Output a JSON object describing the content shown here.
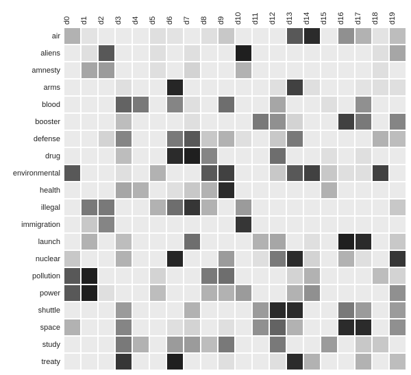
{
  "chart_data": {
    "type": "heatmap",
    "title": "",
    "xlabel": "",
    "ylabel": "",
    "row_labels": [
      "air",
      "aliens",
      "amnesty",
      "arms",
      "blood",
      "booster",
      "defense",
      "drug",
      "environmental",
      "health",
      "illegal",
      "immigration",
      "launch",
      "nuclear",
      "pollution",
      "power",
      "shuttle",
      "space",
      "study",
      "treaty"
    ],
    "col_labels": [
      "d0",
      "d1",
      "d2",
      "d3",
      "d4",
      "d5",
      "d6",
      "d7",
      "d8",
      "d9",
      "d10",
      "d11",
      "d12",
      "d13",
      "d14",
      "d15",
      "d16",
      "d17",
      "d18",
      "d19"
    ],
    "value_range": [
      0,
      1
    ],
    "matrix": [
      [
        0.3,
        0.08,
        0.05,
        0.05,
        0.05,
        0.1,
        0.08,
        0.05,
        0.1,
        0.2,
        0.05,
        0.05,
        0.05,
        0.7,
        0.9,
        0.05,
        0.45,
        0.3,
        0.08,
        0.25
      ],
      [
        0.05,
        0.1,
        0.7,
        0.05,
        0.05,
        0.1,
        0.05,
        0.1,
        0.05,
        0.05,
        0.95,
        0.05,
        0.05,
        0.05,
        0.05,
        0.05,
        0.05,
        0.05,
        0.1,
        0.35
      ],
      [
        0.05,
        0.35,
        0.4,
        0.05,
        0.05,
        0.1,
        0.05,
        0.15,
        0.05,
        0.05,
        0.3,
        0.05,
        0.05,
        0.05,
        0.05,
        0.05,
        0.05,
        0.05,
        0.1,
        0.05
      ],
      [
        0.05,
        0.05,
        0.05,
        0.1,
        0.05,
        0.05,
        0.92,
        0.05,
        0.05,
        0.05,
        0.05,
        0.05,
        0.1,
        0.8,
        0.1,
        0.05,
        0.05,
        0.08,
        0.1,
        0.1
      ],
      [
        0.05,
        0.05,
        0.05,
        0.65,
        0.55,
        0.05,
        0.5,
        0.1,
        0.05,
        0.6,
        0.05,
        0.05,
        0.35,
        0.05,
        0.05,
        0.1,
        0.05,
        0.45,
        0.05,
        0.05
      ],
      [
        0.05,
        0.05,
        0.05,
        0.25,
        0.05,
        0.05,
        0.05,
        0.1,
        0.05,
        0.05,
        0.05,
        0.55,
        0.45,
        0.15,
        0.05,
        0.05,
        0.8,
        0.55,
        0.05,
        0.5
      ],
      [
        0.05,
        0.05,
        0.15,
        0.5,
        0.05,
        0.05,
        0.55,
        0.7,
        0.2,
        0.3,
        0.1,
        0.05,
        0.2,
        0.55,
        0.05,
        0.05,
        0.05,
        0.05,
        0.3,
        0.25
      ],
      [
        0.05,
        0.05,
        0.05,
        0.25,
        0.05,
        0.05,
        0.9,
        0.95,
        0.5,
        0.05,
        0.05,
        0.05,
        0.6,
        0.05,
        0.05,
        0.1,
        0.05,
        0.1,
        0.05,
        0.05
      ],
      [
        0.7,
        0.05,
        0.05,
        0.1,
        0.05,
        0.3,
        0.05,
        0.05,
        0.7,
        0.8,
        0.05,
        0.05,
        0.2,
        0.7,
        0.8,
        0.2,
        0.1,
        0.1,
        0.8,
        0.05
      ],
      [
        0.05,
        0.05,
        0.05,
        0.35,
        0.3,
        0.05,
        0.1,
        0.2,
        0.3,
        0.9,
        0.05,
        0.05,
        0.05,
        0.05,
        0.05,
        0.3,
        0.05,
        0.05,
        0.05,
        0.05
      ],
      [
        0.05,
        0.55,
        0.55,
        0.05,
        0.05,
        0.3,
        0.6,
        0.85,
        0.3,
        0.05,
        0.4,
        0.05,
        0.05,
        0.05,
        0.05,
        0.05,
        0.05,
        0.05,
        0.05,
        0.2
      ],
      [
        0.05,
        0.2,
        0.5,
        0.05,
        0.05,
        0.05,
        0.05,
        0.05,
        0.05,
        0.05,
        0.85,
        0.05,
        0.05,
        0.05,
        0.05,
        0.05,
        0.05,
        0.05,
        0.05,
        0.05
      ],
      [
        0.05,
        0.3,
        0.05,
        0.25,
        0.05,
        0.05,
        0.05,
        0.6,
        0.05,
        0.05,
        0.05,
        0.3,
        0.35,
        0.05,
        0.1,
        0.05,
        0.95,
        0.9,
        0.05,
        0.2
      ],
      [
        0.2,
        0.05,
        0.05,
        0.3,
        0.05,
        0.05,
        0.92,
        0.05,
        0.05,
        0.4,
        0.05,
        0.1,
        0.55,
        0.9,
        0.15,
        0.05,
        0.3,
        0.1,
        0.05,
        0.85
      ],
      [
        0.7,
        0.95,
        0.05,
        0.05,
        0.05,
        0.15,
        0.05,
        0.05,
        0.55,
        0.6,
        0.05,
        0.05,
        0.05,
        0.15,
        0.3,
        0.05,
        0.05,
        0.05,
        0.25,
        0.15
      ],
      [
        0.7,
        0.95,
        0.1,
        0.05,
        0.05,
        0.25,
        0.05,
        0.05,
        0.3,
        0.3,
        0.4,
        0.05,
        0.05,
        0.3,
        0.45,
        0.05,
        0.05,
        0.05,
        0.05,
        0.45
      ],
      [
        0.05,
        0.05,
        0.05,
        0.4,
        0.05,
        0.05,
        0.05,
        0.3,
        0.05,
        0.05,
        0.05,
        0.4,
        0.9,
        0.9,
        0.05,
        0.05,
        0.55,
        0.4,
        0.05,
        0.4
      ],
      [
        0.3,
        0.05,
        0.05,
        0.5,
        0.05,
        0.05,
        0.1,
        0.15,
        0.05,
        0.1,
        0.05,
        0.45,
        0.65,
        0.3,
        0.05,
        0.05,
        0.9,
        0.9,
        0.05,
        0.45
      ],
      [
        0.05,
        0.05,
        0.05,
        0.55,
        0.3,
        0.05,
        0.4,
        0.4,
        0.25,
        0.55,
        0.05,
        0.05,
        0.55,
        0.05,
        0.05,
        0.4,
        0.05,
        0.2,
        0.2,
        0.05
      ],
      [
        0.05,
        0.05,
        0.05,
        0.85,
        0.05,
        0.05,
        0.95,
        0.05,
        0.05,
        0.1,
        0.05,
        0.05,
        0.1,
        0.9,
        0.3,
        0.05,
        0.05,
        0.3,
        0.05,
        0.25
      ]
    ]
  }
}
